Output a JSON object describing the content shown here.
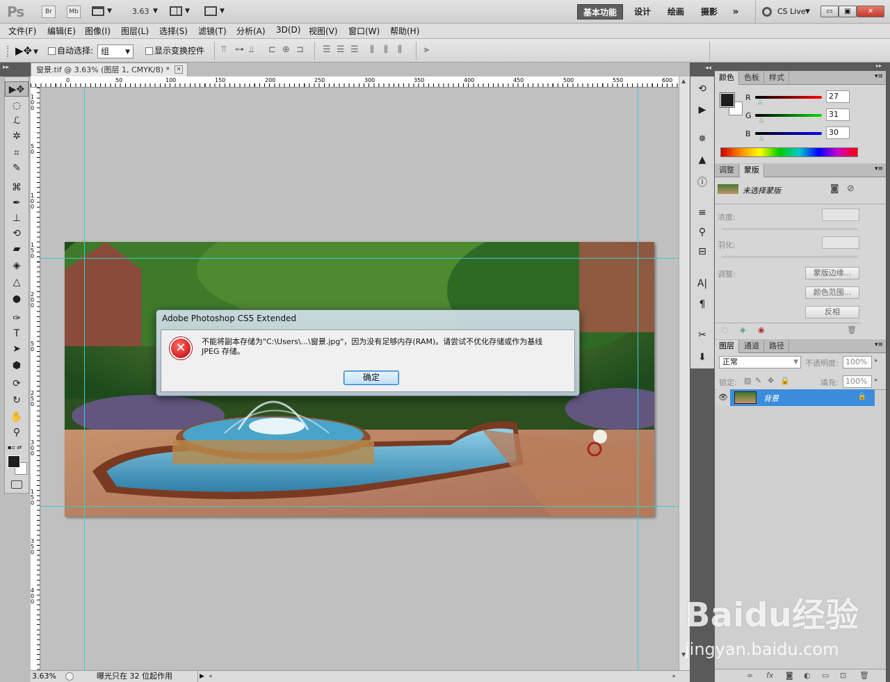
{
  "app": {
    "logo": "Ps",
    "br": "Br",
    "mb": "Mb",
    "zoom": "3.63"
  },
  "workspaces": [
    "基本功能",
    "设计",
    "绘画",
    "摄影"
  ],
  "workspace_more": "»",
  "cs_live": "CS Live",
  "window_buttons": {
    "min": "▭",
    "max": "▣",
    "close": "✕"
  },
  "menu": [
    "文件(F)",
    "编辑(E)",
    "图像(I)",
    "图层(L)",
    "选择(S)",
    "滤镜(T)",
    "分析(A)",
    "3D(D)",
    "视图(V)",
    "窗口(W)",
    "帮助(H)"
  ],
  "options": {
    "auto_select_label": "自动选择:",
    "auto_select_value": "组",
    "show_transform_label": "显示变换控件"
  },
  "document": {
    "tab_title": "窗景.tif @ 3.63% (图层 1, CMYK/8) *",
    "close": "✕"
  },
  "ruler_h": [
    "0",
    "50",
    "100",
    "150",
    "200",
    "250",
    "300",
    "350",
    "400",
    "450",
    "500",
    "550",
    "600"
  ],
  "ruler_v": [
    "100",
    "50",
    "100",
    "150",
    "200",
    "50",
    "250",
    "300",
    "150",
    "350",
    "400"
  ],
  "status": {
    "zoom": "3.63%",
    "info": "曝光只在 32 位起作用"
  },
  "color_panel": {
    "tabs": [
      "颜色",
      "色板",
      "样式"
    ],
    "r_label": "R",
    "g_label": "G",
    "b_label": "B",
    "r": "27",
    "g": "31",
    "b": "30",
    "fg": "#1b1f1e",
    "bg": "#ffffff"
  },
  "mask_panel": {
    "tabs": [
      "调整",
      "蒙版"
    ],
    "no_mask": "未选择蒙版",
    "density": "浓度:",
    "feather": "羽化:",
    "refine": "调整:",
    "btn_edge": "蒙版边缘...",
    "btn_range": "颜色范围...",
    "btn_invert": "反相"
  },
  "layers_panel": {
    "tabs": [
      "图层",
      "通道",
      "路径"
    ],
    "blend_mode": "正常",
    "opacity_label": "不透明度:",
    "opacity": "100%",
    "lock_label": "锁定:",
    "fill_label": "填充:",
    "fill": "100%",
    "layer_name": "背景"
  },
  "dialog": {
    "title": "Adobe Photoshop CS5 Extended",
    "message_line1": "不能将副本存储为\"C:\\Users\\...\\窗景.jpg\"，因为没有足够内存(RAM)。请尝试不优化存储或作为基线",
    "message_line2": "JPEG 存储。",
    "ok": "确定"
  },
  "watermark": {
    "brand": "Baidu经验",
    "url": "jingyan.baidu.com"
  }
}
